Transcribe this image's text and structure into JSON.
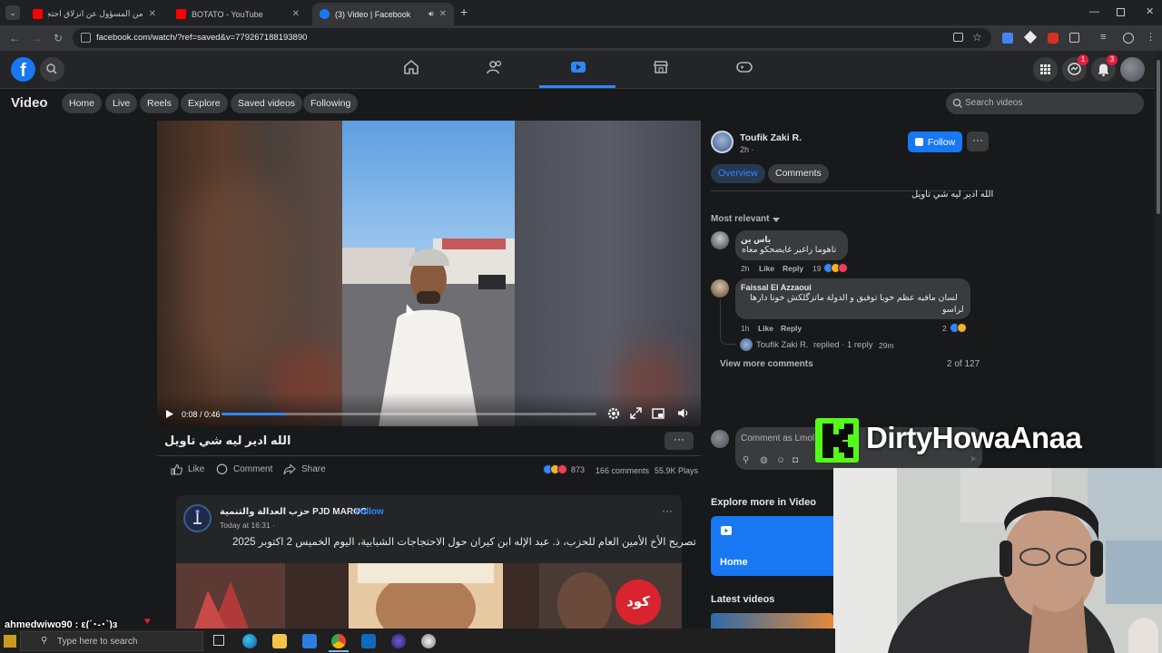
{
  "browser": {
    "tabs": [
      {
        "title": "من المسؤول عن انزلاق احتجاجات",
        "active": false
      },
      {
        "title": "BOTATO - YouTube",
        "active": false
      },
      {
        "title": "(3) Video | Facebook",
        "active": true
      }
    ],
    "url": "facebook.com/watch/?ref=saved&v=779267188193890"
  },
  "header": {
    "messenger_badge": "1",
    "notifications_badge": "3"
  },
  "video_nav": {
    "title": "Video",
    "pills": [
      "Home",
      "Live",
      "Reels",
      "Explore",
      "Saved videos",
      "Following"
    ],
    "search_placeholder": "Search videos"
  },
  "player": {
    "time": "0:08 / 0:46",
    "progress": 0.17,
    "caption": "الله ادير ليه شي تاويل"
  },
  "actions": {
    "like": "Like",
    "comment": "Comment",
    "share": "Share",
    "reaction_count": "873",
    "comments": "166 comments",
    "plays": "55.9K Plays"
  },
  "author": {
    "name": "Toufik Zaki R.",
    "time": "2h ·",
    "follow": "Follow",
    "tab_overview": "Overview",
    "tab_comments": "Comments",
    "description": "الله ادير ليه شي تاويل"
  },
  "comments": {
    "sort": "Most relevant",
    "items": [
      {
        "name": "ياس ين",
        "text": "تاهوما راغير غايضحكو معاه",
        "time": "2h",
        "like": "Like",
        "reply": "Reply",
        "count": "19"
      },
      {
        "name": "Faissal El Azzaoui",
        "text": "لسان مافيه عظم خويا توفيق و الدولة ماتزگلكش خونا دارها",
        "text2": "لراسو",
        "time": "1h",
        "like": "Like",
        "reply": "Reply",
        "count": "2"
      }
    ],
    "reply_author": "Toufik Zaki R.",
    "reply_text": "replied · 1 reply",
    "reply_time": "29m",
    "view_more": "View more comments",
    "counter": "2 of 127",
    "comment_as": "Comment as Lmol"
  },
  "overlay": {
    "brand": "DirtyHowaAnaa",
    "chat": "ahmedwiwo90 : ε(´･-･`)з"
  },
  "next_post": {
    "page": "حزب العدالة والتنمية PJD MAROC",
    "follow": "Follow",
    "time": "Today at 16:31 ·",
    "text": "تصريح الأخ الأمين العام للحزب، ذ. عبد الإله ابن كيران حول الاحتجاجات الشبابية، اليوم الخميس 2 اكتوبر 2025",
    "stamp": "كود"
  },
  "explore": {
    "title": "Explore more in Video",
    "home": "Home",
    "latest": "Latest videos"
  },
  "taskbar": {
    "search": "Type here to search"
  }
}
